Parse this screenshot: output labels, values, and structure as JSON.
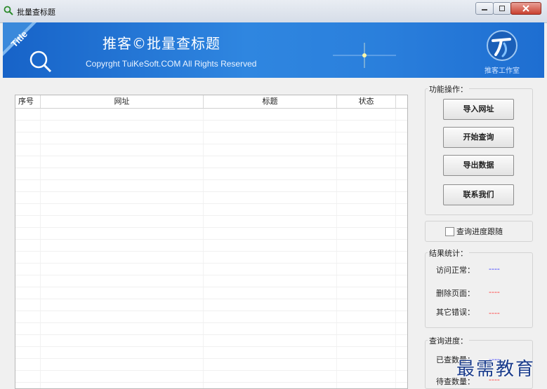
{
  "window": {
    "title": "批量查标题",
    "buttons": [
      "minimize",
      "maximize",
      "close"
    ]
  },
  "banner": {
    "ribbon_text": "Title",
    "title": "推客©批量查标题",
    "copyright": "Copyrght TuiKeSoft.COM All Rights Reserved",
    "logo_caption": "推客工作室",
    "logo_icon": "tk-logo-icon"
  },
  "table": {
    "columns": [
      "序号",
      "网址",
      "标题",
      "状态"
    ],
    "rows": []
  },
  "actions": {
    "label": "功能操作：",
    "buttons": [
      "导入网址",
      "开始查询",
      "导出数据",
      "联系我们"
    ]
  },
  "follow_progress": {
    "label": "查询进度跟随",
    "checked": false
  },
  "results": {
    "label": "结果统计：",
    "items": [
      {
        "label": "访问正常：",
        "value": "----",
        "color": "#3333ff"
      },
      {
        "label": "删除页面：",
        "value": "----",
        "color": "#ff3333"
      },
      {
        "label": "其它错误：",
        "value": "----",
        "color": "#ff3333"
      }
    ]
  },
  "progress": {
    "label": "查询进度：",
    "items": [
      {
        "label": "已查数量：",
        "value": "----",
        "color": "#3333ff"
      },
      {
        "label": "待查数量：",
        "value": "----",
        "color": "#ff3333"
      }
    ]
  },
  "watermark": "最需教育",
  "colors": {
    "banner_blue": "#2a7fdc",
    "accent_blue": "#3333ff",
    "accent_red": "#ff3333"
  }
}
